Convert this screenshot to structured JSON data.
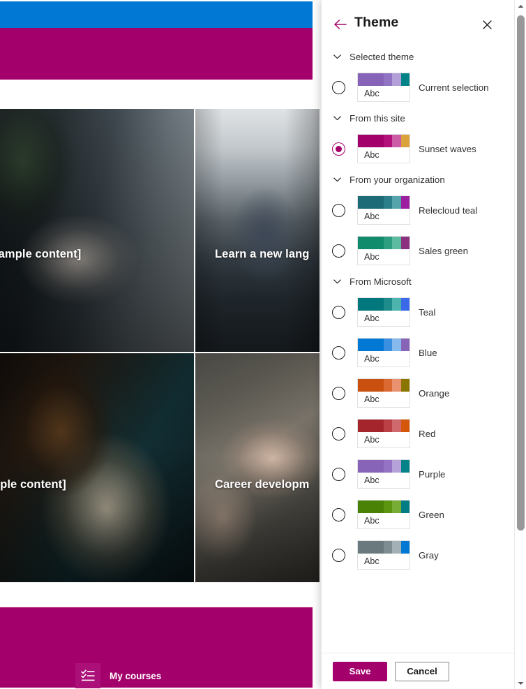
{
  "background": {
    "tiles": [
      {
        "caption": "s [Sample content]",
        "image": "handshake-photo"
      },
      {
        "caption": "Learn a new lang",
        "image": "office-meeting-photo"
      },
      {
        "caption": "Sample content]",
        "image": "woman-at-desk-photo"
      },
      {
        "caption": "Career developm",
        "image": "hands-together-photo"
      }
    ],
    "footer": {
      "label": "My courses",
      "icon": "checklist-icon"
    },
    "colors": {
      "topbar": "#0078d4",
      "band": "#a4006b",
      "footer": "#a4006b"
    }
  },
  "panel": {
    "title": "Theme",
    "back_icon": "back-arrow-icon",
    "close_icon": "close-icon",
    "chevron_icon": "chevron-down-icon",
    "accent": "#a4006b",
    "sections": [
      {
        "id": "selected-theme",
        "label": "Selected theme",
        "themes": [
          {
            "name": "Current selection",
            "sample_text": "Abc",
            "selected": false,
            "colors": [
              "#8763b8",
              "#9173c4",
              "#b4a0d9",
              "#038387"
            ]
          }
        ]
      },
      {
        "id": "from-this-site",
        "label": "From this site",
        "themes": [
          {
            "name": "Sunset waves",
            "sample_text": "Abc",
            "selected": true,
            "colors": [
              "#a4006b",
              "#b3107c",
              "#cc5ca6",
              "#d9a23a"
            ]
          }
        ]
      },
      {
        "id": "from-your-organization",
        "label": "From your organization",
        "themes": [
          {
            "name": "Relecloud teal",
            "sample_text": "Abc",
            "selected": false,
            "colors": [
              "#1d6b76",
              "#2b7f8a",
              "#55a3ab",
              "#9c1fa0"
            ]
          },
          {
            "name": "Sales green",
            "sample_text": "Abc",
            "selected": false,
            "colors": [
              "#108b6b",
              "#2d9e80",
              "#5cbba0",
              "#8c3080"
            ]
          }
        ]
      },
      {
        "id": "from-microsoft",
        "label": "From Microsoft",
        "themes": [
          {
            "name": "Teal",
            "sample_text": "Abc",
            "selected": false,
            "colors": [
              "#03787c",
              "#1f8c8c",
              "#4cb3ad",
              "#3a6ae8"
            ]
          },
          {
            "name": "Blue",
            "sample_text": "Abc",
            "selected": false,
            "colors": [
              "#0078d4",
              "#3b8fe0",
              "#86b9ec",
              "#8764b8"
            ]
          },
          {
            "name": "Orange",
            "sample_text": "Abc",
            "selected": false,
            "colors": [
              "#ca5010",
              "#da6a31",
              "#ea9170",
              "#8a7500"
            ]
          },
          {
            "name": "Red",
            "sample_text": "Abc",
            "selected": false,
            "colors": [
              "#a4262c",
              "#bb4046",
              "#d0696e",
              "#d4570c"
            ]
          },
          {
            "name": "Purple",
            "sample_text": "Abc",
            "selected": false,
            "colors": [
              "#8764b8",
              "#9473c4",
              "#b5a2d9",
              "#038387"
            ]
          },
          {
            "name": "Green",
            "sample_text": "Abc",
            "selected": false,
            "colors": [
              "#498205",
              "#5c9610",
              "#78ad35",
              "#027d84"
            ]
          },
          {
            "name": "Gray",
            "sample_text": "Abc",
            "selected": false,
            "colors": [
              "#69797e",
              "#7e8d92",
              "#a3b0b5",
              "#0078d4"
            ]
          }
        ]
      }
    ],
    "footer": {
      "save_label": "Save",
      "cancel_label": "Cancel"
    },
    "scrollbar": {
      "up_icon": "scroll-up-arrow-icon",
      "down_icon": "scroll-down-arrow-icon"
    }
  }
}
